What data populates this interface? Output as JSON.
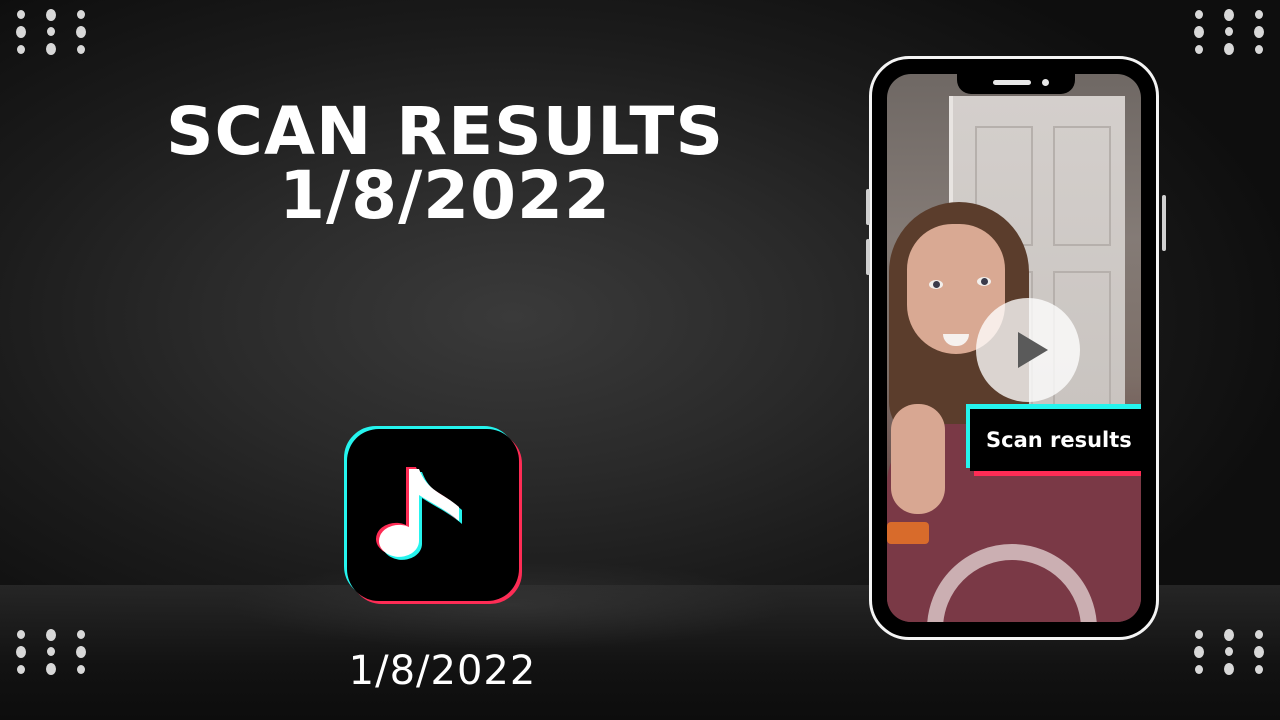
{
  "title": {
    "line1": "SCAN RESULTS",
    "line2": "1/8/2022"
  },
  "date_caption": "1/8/2022",
  "phone": {
    "overlay_label": "Scan results",
    "play_icon": "play-icon"
  },
  "icons": {
    "app_logo": "tiktok-icon"
  },
  "colors": {
    "accent_cyan": "#25f4ee",
    "accent_red": "#fe2c55",
    "text": "#ffffff"
  }
}
